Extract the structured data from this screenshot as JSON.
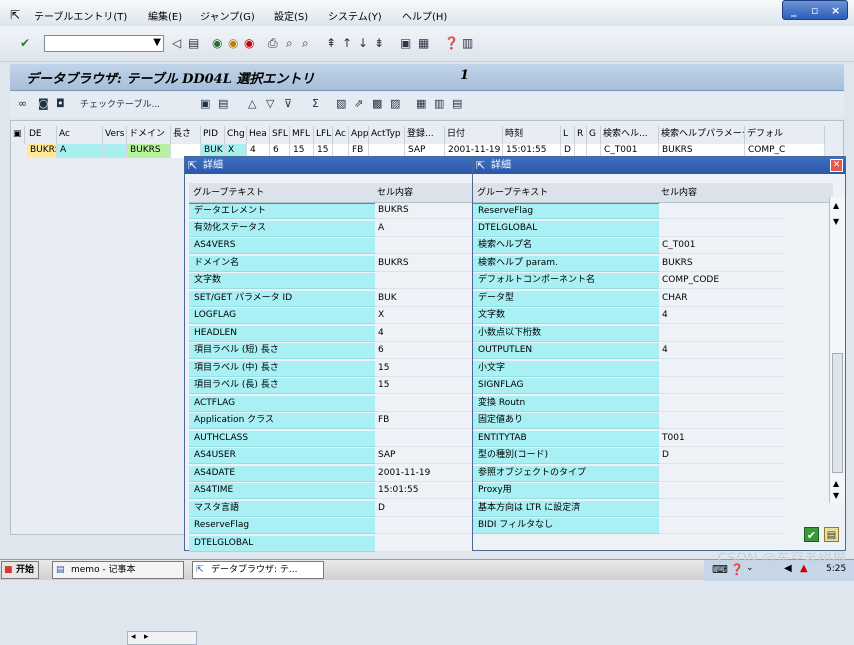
{
  "menu": {
    "items": [
      "テーブルエントリ(T)",
      "編集(E)",
      "ジャンプ(G)",
      "設定(S)",
      "システム(Y)",
      "ヘルプ(H)"
    ]
  },
  "window_controls": {
    "minimize": "_",
    "restore": "▫",
    "close": "×"
  },
  "title": {
    "text": "データブラウザ: テーブル DD04L 選択エントリ",
    "count": "1"
  },
  "app_toolbar": {
    "check_table_label": "チェックテーブル..."
  },
  "grid": {
    "columns": [
      "DE",
      "Ac",
      "Vers",
      "ドメイン",
      "長さ",
      "PID",
      "Chg",
      "Hea",
      "SFL",
      "MFL",
      "LFL",
      "Ac",
      "Appl",
      "ActTyp",
      "登録...",
      "日付",
      "時刻",
      "L",
      "R",
      "G",
      "検索ヘル...",
      "検索ヘルプパラメータ",
      "デフォル"
    ],
    "row": [
      "BUKRS",
      "A",
      "",
      "BUKRS",
      "",
      "BUK",
      "X",
      "4",
      "6",
      "15",
      "15",
      "",
      "FB",
      "",
      "SAP",
      "2001-11-19",
      "15:01:55",
      "D",
      "",
      "",
      "C_T001",
      "BUKRS",
      "COMP_C"
    ]
  },
  "detail1": {
    "title": "詳細",
    "col_group": "グループテキスト",
    "col_cell": "セル内容",
    "rows": [
      {
        "k": "データエレメント",
        "v": "BUKRS"
      },
      {
        "k": "有効化ステータス",
        "v": "A"
      },
      {
        "k": "AS4VERS",
        "v": ""
      },
      {
        "k": "ドメイン名",
        "v": "BUKRS"
      },
      {
        "k": "文字数",
        "v": ""
      },
      {
        "k": "SET/GET パラメータ ID",
        "v": "BUK"
      },
      {
        "k": "LOGFLAG",
        "v": "X"
      },
      {
        "k": "HEADLEN",
        "v": "4"
      },
      {
        "k": "項目ラベル (短) 長さ",
        "v": "6"
      },
      {
        "k": "項目ラベル (中) 長さ",
        "v": "15"
      },
      {
        "k": "項目ラベル (長) 長さ",
        "v": "15"
      },
      {
        "k": "ACTFLAG",
        "v": ""
      },
      {
        "k": "Application クラス",
        "v": "FB"
      },
      {
        "k": "AUTHCLASS",
        "v": ""
      },
      {
        "k": "AS4USER",
        "v": "SAP"
      },
      {
        "k": "AS4DATE",
        "v": "2001-11-19"
      },
      {
        "k": "AS4TIME",
        "v": "15:01:55"
      },
      {
        "k": "マスタ言語",
        "v": "D"
      },
      {
        "k": "ReserveFlag",
        "v": ""
      },
      {
        "k": "DTELGLOBAL",
        "v": ""
      }
    ]
  },
  "detail2": {
    "title": "詳細",
    "col_group": "グループテキスト",
    "col_cell": "セル内容",
    "rows": [
      {
        "k": "ReserveFlag",
        "v": ""
      },
      {
        "k": "DTELGLOBAL",
        "v": ""
      },
      {
        "k": "検索ヘルプ名",
        "v": "C_T001"
      },
      {
        "k": "検索ヘルプ param.",
        "v": "BUKRS"
      },
      {
        "k": "デフォルトコンポーネント名",
        "v": "COMP_CODE"
      },
      {
        "k": "データ型",
        "v": "CHAR"
      },
      {
        "k": "文字数",
        "v": "4"
      },
      {
        "k": "小数点以下桁数",
        "v": ""
      },
      {
        "k": "OUTPUTLEN",
        "v": "4"
      },
      {
        "k": "小文字",
        "v": ""
      },
      {
        "k": "SIGNFLAG",
        "v": ""
      },
      {
        "k": "変換 Routn",
        "v": ""
      },
      {
        "k": "固定値あり",
        "v": ""
      },
      {
        "k": "ENTITYTAB",
        "v": "T001"
      },
      {
        "k": "型の種別(コード)",
        "v": "D"
      },
      {
        "k": "参照オブジェクトのタイプ",
        "v": ""
      },
      {
        "k": "Proxy用",
        "v": ""
      },
      {
        "k": "基本方向は LTR に設定済",
        "v": ""
      },
      {
        "k": "BIDI フィルタなし",
        "v": ""
      }
    ]
  },
  "taskbar": {
    "start": "开始",
    "task1": "memo - 记事本",
    "task2": "データブラウザ: テ...",
    "clock": "5:25"
  },
  "watermark": "CSDN @东京老树根",
  "colors": {
    "cyan": "#a8f0f4",
    "yellow": "#ffe89a",
    "green": "#b8f2a0",
    "title_blue": "#2b57a8"
  }
}
